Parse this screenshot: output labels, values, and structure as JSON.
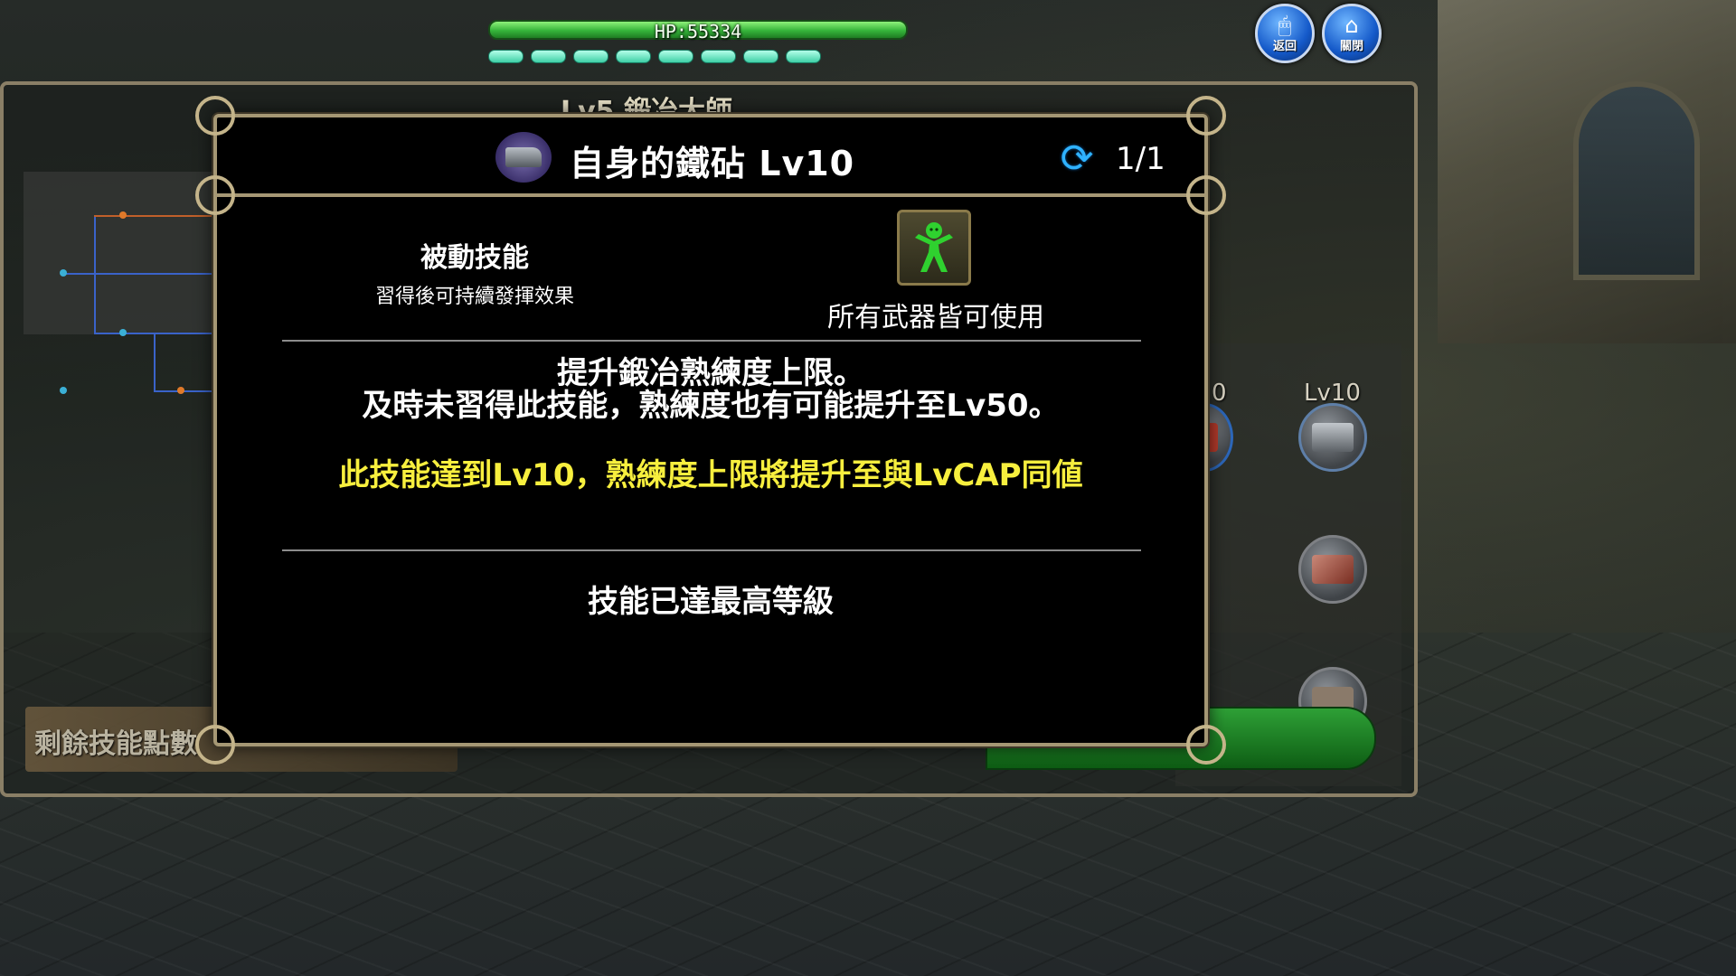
{
  "hud": {
    "hp_text": "HP:55334",
    "hp_fraction": 1.0,
    "stamina_pips": 8
  },
  "top_buttons": {
    "back_label": "返回",
    "close_label": "關閉"
  },
  "background_window": {
    "title": "Lv5  鍛冶大師",
    "right_column_lv_partial": "0",
    "right_column_lv": "Lv10",
    "remaining_points_label": "剩餘技能點數"
  },
  "dialog": {
    "title": "自身的鐵砧 Lv10",
    "page": "1/1",
    "skill_type": "被動技能",
    "skill_type_desc": "習得後可持續發揮效果",
    "weapon_requirement": "所有武器皆可使用",
    "description": [
      "提升鍛冶熟練度上限。",
      "及時未習得此技能，熟練度也有可能提升至Lv50。"
    ],
    "highlight": "此技能達到Lv10，熟練度上限將提升至與LvCAP同値",
    "status": "技能已達最高等級"
  },
  "colors": {
    "highlight": "#f7ef3e",
    "hp_bar": "#35b43a",
    "dialog_border": "#a59774"
  }
}
